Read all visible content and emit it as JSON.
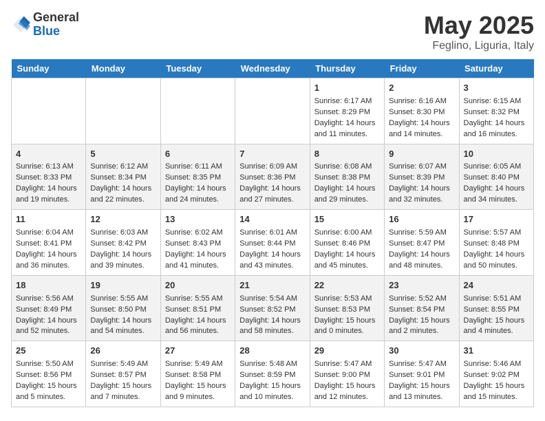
{
  "header": {
    "logo_general": "General",
    "logo_blue": "Blue",
    "title": "May 2025",
    "subtitle": "Feglino, Liguria, Italy"
  },
  "calendar": {
    "days_of_week": [
      "Sunday",
      "Monday",
      "Tuesday",
      "Wednesday",
      "Thursday",
      "Friday",
      "Saturday"
    ],
    "weeks": [
      [
        {
          "day": "",
          "content": ""
        },
        {
          "day": "",
          "content": ""
        },
        {
          "day": "",
          "content": ""
        },
        {
          "day": "",
          "content": ""
        },
        {
          "day": "1",
          "content": "Sunrise: 6:17 AM\nSunset: 8:29 PM\nDaylight: 14 hours\nand 11 minutes."
        },
        {
          "day": "2",
          "content": "Sunrise: 6:16 AM\nSunset: 8:30 PM\nDaylight: 14 hours\nand 14 minutes."
        },
        {
          "day": "3",
          "content": "Sunrise: 6:15 AM\nSunset: 8:32 PM\nDaylight: 14 hours\nand 16 minutes."
        }
      ],
      [
        {
          "day": "4",
          "content": "Sunrise: 6:13 AM\nSunset: 8:33 PM\nDaylight: 14 hours\nand 19 minutes."
        },
        {
          "day": "5",
          "content": "Sunrise: 6:12 AM\nSunset: 8:34 PM\nDaylight: 14 hours\nand 22 minutes."
        },
        {
          "day": "6",
          "content": "Sunrise: 6:11 AM\nSunset: 8:35 PM\nDaylight: 14 hours\nand 24 minutes."
        },
        {
          "day": "7",
          "content": "Sunrise: 6:09 AM\nSunset: 8:36 PM\nDaylight: 14 hours\nand 27 minutes."
        },
        {
          "day": "8",
          "content": "Sunrise: 6:08 AM\nSunset: 8:38 PM\nDaylight: 14 hours\nand 29 minutes."
        },
        {
          "day": "9",
          "content": "Sunrise: 6:07 AM\nSunset: 8:39 PM\nDaylight: 14 hours\nand 32 minutes."
        },
        {
          "day": "10",
          "content": "Sunrise: 6:05 AM\nSunset: 8:40 PM\nDaylight: 14 hours\nand 34 minutes."
        }
      ],
      [
        {
          "day": "11",
          "content": "Sunrise: 6:04 AM\nSunset: 8:41 PM\nDaylight: 14 hours\nand 36 minutes."
        },
        {
          "day": "12",
          "content": "Sunrise: 6:03 AM\nSunset: 8:42 PM\nDaylight: 14 hours\nand 39 minutes."
        },
        {
          "day": "13",
          "content": "Sunrise: 6:02 AM\nSunset: 8:43 PM\nDaylight: 14 hours\nand 41 minutes."
        },
        {
          "day": "14",
          "content": "Sunrise: 6:01 AM\nSunset: 8:44 PM\nDaylight: 14 hours\nand 43 minutes."
        },
        {
          "day": "15",
          "content": "Sunrise: 6:00 AM\nSunset: 8:46 PM\nDaylight: 14 hours\nand 45 minutes."
        },
        {
          "day": "16",
          "content": "Sunrise: 5:59 AM\nSunset: 8:47 PM\nDaylight: 14 hours\nand 48 minutes."
        },
        {
          "day": "17",
          "content": "Sunrise: 5:57 AM\nSunset: 8:48 PM\nDaylight: 14 hours\nand 50 minutes."
        }
      ],
      [
        {
          "day": "18",
          "content": "Sunrise: 5:56 AM\nSunset: 8:49 PM\nDaylight: 14 hours\nand 52 minutes."
        },
        {
          "day": "19",
          "content": "Sunrise: 5:55 AM\nSunset: 8:50 PM\nDaylight: 14 hours\nand 54 minutes."
        },
        {
          "day": "20",
          "content": "Sunrise: 5:55 AM\nSunset: 8:51 PM\nDaylight: 14 hours\nand 56 minutes."
        },
        {
          "day": "21",
          "content": "Sunrise: 5:54 AM\nSunset: 8:52 PM\nDaylight: 14 hours\nand 58 minutes."
        },
        {
          "day": "22",
          "content": "Sunrise: 5:53 AM\nSunset: 8:53 PM\nDaylight: 15 hours\nand 0 minutes."
        },
        {
          "day": "23",
          "content": "Sunrise: 5:52 AM\nSunset: 8:54 PM\nDaylight: 15 hours\nand 2 minutes."
        },
        {
          "day": "24",
          "content": "Sunrise: 5:51 AM\nSunset: 8:55 PM\nDaylight: 15 hours\nand 4 minutes."
        }
      ],
      [
        {
          "day": "25",
          "content": "Sunrise: 5:50 AM\nSunset: 8:56 PM\nDaylight: 15 hours\nand 5 minutes."
        },
        {
          "day": "26",
          "content": "Sunrise: 5:49 AM\nSunset: 8:57 PM\nDaylight: 15 hours\nand 7 minutes."
        },
        {
          "day": "27",
          "content": "Sunrise: 5:49 AM\nSunset: 8:58 PM\nDaylight: 15 hours\nand 9 minutes."
        },
        {
          "day": "28",
          "content": "Sunrise: 5:48 AM\nSunset: 8:59 PM\nDaylight: 15 hours\nand 10 minutes."
        },
        {
          "day": "29",
          "content": "Sunrise: 5:47 AM\nSunset: 9:00 PM\nDaylight: 15 hours\nand 12 minutes."
        },
        {
          "day": "30",
          "content": "Sunrise: 5:47 AM\nSunset: 9:01 PM\nDaylight: 15 hours\nand 13 minutes."
        },
        {
          "day": "31",
          "content": "Sunrise: 5:46 AM\nSunset: 9:02 PM\nDaylight: 15 hours\nand 15 minutes."
        }
      ]
    ]
  }
}
